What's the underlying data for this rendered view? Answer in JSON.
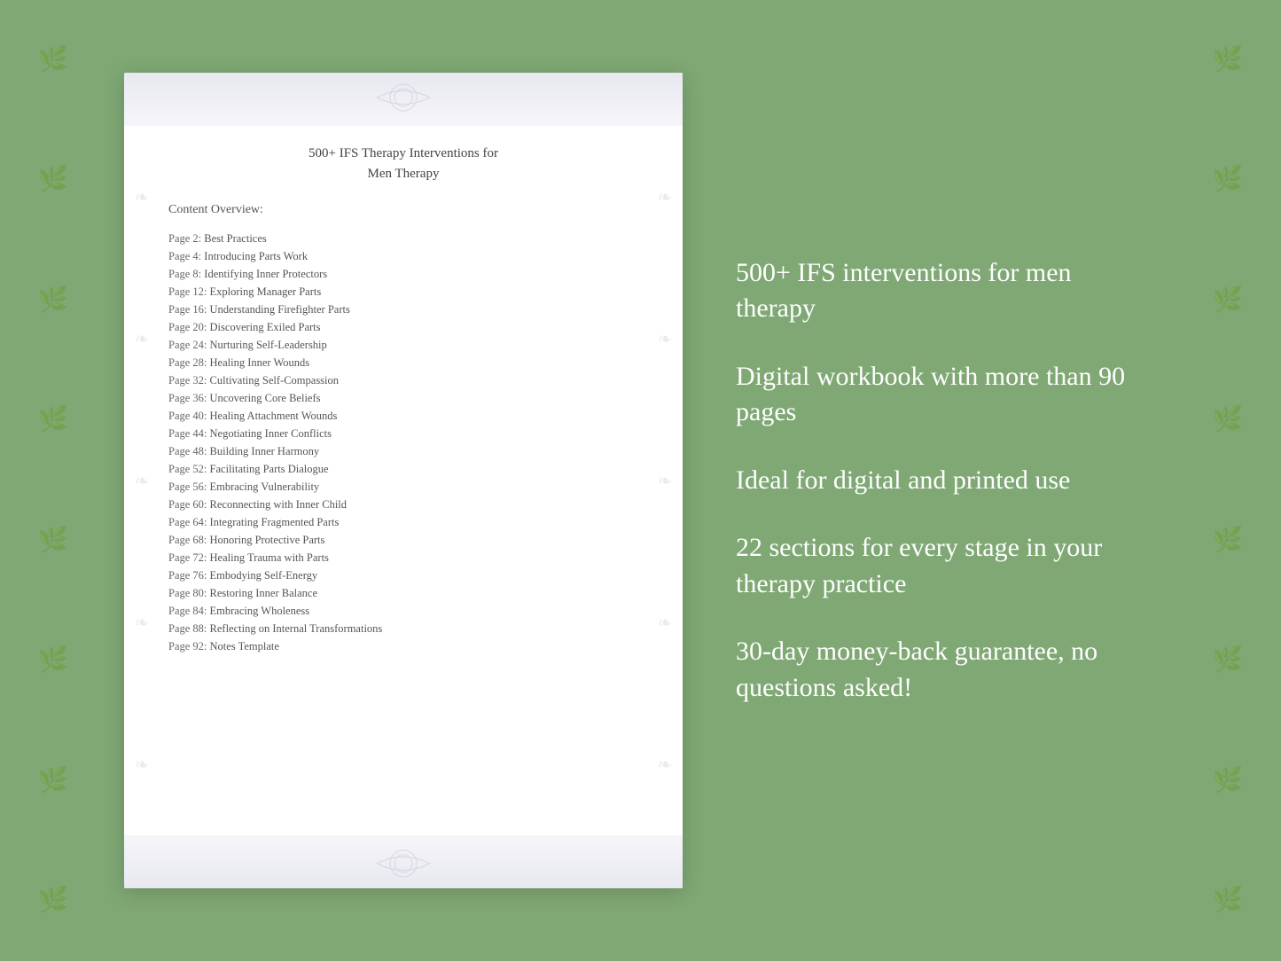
{
  "background": {
    "color": "#7fa874"
  },
  "document": {
    "title_line1": "500+ IFS Therapy Interventions for",
    "title_line2": "Men Therapy",
    "content_label": "Content Overview:",
    "toc_items": [
      {
        "page": "Page  2:",
        "title": "Best Practices"
      },
      {
        "page": "Page  4:",
        "title": "Introducing Parts Work"
      },
      {
        "page": "Page  8:",
        "title": "Identifying Inner Protectors"
      },
      {
        "page": "Page 12:",
        "title": "Exploring Manager Parts"
      },
      {
        "page": "Page 16:",
        "title": "Understanding Firefighter Parts"
      },
      {
        "page": "Page 20:",
        "title": "Discovering Exiled Parts"
      },
      {
        "page": "Page 24:",
        "title": "Nurturing Self-Leadership"
      },
      {
        "page": "Page 28:",
        "title": "Healing Inner Wounds"
      },
      {
        "page": "Page 32:",
        "title": "Cultivating Self-Compassion"
      },
      {
        "page": "Page 36:",
        "title": "Uncovering Core Beliefs"
      },
      {
        "page": "Page 40:",
        "title": "Healing Attachment Wounds"
      },
      {
        "page": "Page 44:",
        "title": "Negotiating Inner Conflicts"
      },
      {
        "page": "Page 48:",
        "title": "Building Inner Harmony"
      },
      {
        "page": "Page 52:",
        "title": "Facilitating Parts Dialogue"
      },
      {
        "page": "Page 56:",
        "title": "Embracing Vulnerability"
      },
      {
        "page": "Page 60:",
        "title": "Reconnecting with Inner Child"
      },
      {
        "page": "Page 64:",
        "title": "Integrating Fragmented Parts"
      },
      {
        "page": "Page 68:",
        "title": "Honoring Protective Parts"
      },
      {
        "page": "Page 72:",
        "title": "Healing Trauma with Parts"
      },
      {
        "page": "Page 76:",
        "title": "Embodying Self-Energy"
      },
      {
        "page": "Page 80:",
        "title": "Restoring Inner Balance"
      },
      {
        "page": "Page 84:",
        "title": "Embracing Wholeness"
      },
      {
        "page": "Page 88:",
        "title": "Reflecting on Internal Transformations"
      },
      {
        "page": "Page 92:",
        "title": "Notes Template"
      }
    ]
  },
  "features": [
    "500+ IFS interventions for men therapy",
    "Digital workbook with more than 90 pages",
    "Ideal for digital and printed use",
    "22 sections for every stage in your therapy practice",
    "30-day money-back guarantee, no questions asked!"
  ]
}
